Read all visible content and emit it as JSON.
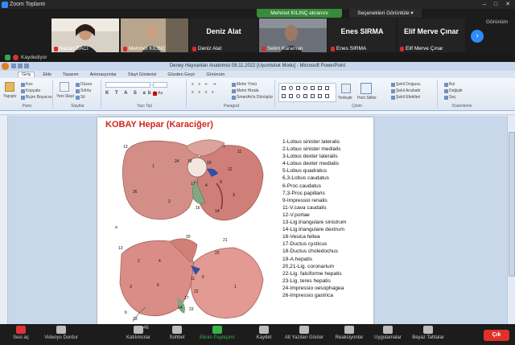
{
  "zoom": {
    "title": "Zoom Toplantı",
    "share_banner": "Mehmet KILINÇ ekranını görüntülüyorsunuz",
    "view_options": "Seçenekleri Görüntüle",
    "gorunum": "Görünüm",
    "recording": "Kaydediyor",
    "participants": [
      {
        "name": "Nazan BACI",
        "has_video": true
      },
      {
        "name": "Mehmet KILINÇ",
        "has_video": true
      },
      {
        "name": "Deniz Alat",
        "big": "Deniz Alat",
        "has_video": false
      },
      {
        "name": "Selim Karaman",
        "has_video": true
      },
      {
        "name": "Enes SIRMA",
        "big": "Enes SIRMA",
        "has_video": false
      },
      {
        "name": "Elif Merve Çınar",
        "big": "Elif Merve Çınar",
        "has_video": false
      }
    ],
    "toolbar": {
      "mute": "Sesi aç",
      "video": "Videoyu Durdur",
      "participants": "Katılımcılar",
      "participants_count": "46",
      "chat": "Sohbet",
      "share": "Ekran Paylaşımı",
      "record": "Kaydet",
      "captions": "Alt Yazıları Göster",
      "reactions": "Reaksiyonlar",
      "apps": "Uygulamalar",
      "whiteboard": "Beyaz Tahtalar",
      "leave": "Çık"
    }
  },
  "ppt": {
    "window_title": "Deney Hayvanları Anatomisi 08.11.2022 [Uyumluluk Modu] - Microsoft PowerPoint",
    "tabs": [
      "Giriş",
      "Ekle",
      "Tasarım",
      "Animasyonlar",
      "Slayt Gösterisi",
      "Gözden Geçir",
      "Görünüm"
    ],
    "active_tab": "Giriş",
    "ribbon": {
      "paste": "Yapıştır",
      "cut": "Kes",
      "copy": "Kopyala",
      "format_painter": "Biçim Boyacısı",
      "clipboard_label": "Pano",
      "new_slide": "Yeni Slayt",
      "layout": "Düzen",
      "reset": "Sıfırla",
      "delete": "Sil",
      "slides_label": "Slaytlar",
      "font_label": "Yazı Tipi",
      "paragraph_label": "Paragraf",
      "text_direction": "Metin Yönü",
      "align_text": "Metni Hizala",
      "smartart": "SmartArt'a Dönüştür",
      "drawing_label": "Çizim",
      "arrange": "Yerleştir",
      "quick_styles": "Hızlı Stiller",
      "shape_fill": "Şekil Dolgusu",
      "shape_outline": "Şekil Anahattı",
      "shape_effects": "Şekil Efektleri",
      "find": "Bul",
      "replace": "Değiştir",
      "select": "Seç",
      "editing_label": "Düzenleme"
    },
    "slide": {
      "title": "KOBAY Hepar (Karaciğer)",
      "legend": [
        "1-Lobus sinister lateralis",
        "2-Lobus sinister medialis",
        "3-Lobus dexter lateralis",
        "4-Lobus dexter medialis",
        "5-Lobus quadratus",
        "6,3-Lobus caudatus",
        "6-Proc.caudatus",
        "7,3-Proc.papillaris",
        "9-Impressio renalis",
        "11-V.cava caudalis",
        "12-V.portae",
        "13-Lig.triangulare sinistrum",
        "14-Lig.triangulare dextrum",
        "16-Vesica fellea",
        "17-Ductus cysticus",
        "18-Ductus choledochus",
        "19-A.hepatis",
        "20,21-Lig. coronarium",
        "22-Lig. falciforme hepatis",
        "23-Lig. teres hepatis",
        "24-Impressio oesophagea",
        "26-Impressio gastrica"
      ]
    }
  }
}
